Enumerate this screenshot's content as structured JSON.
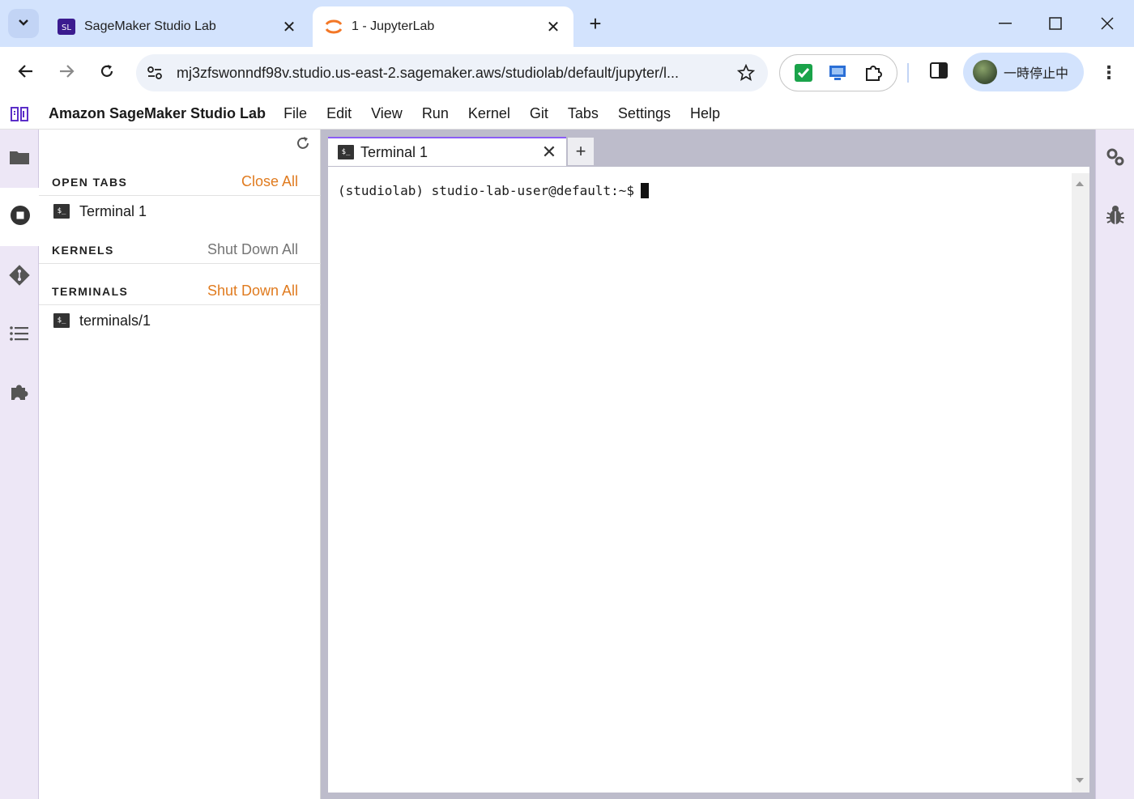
{
  "browser": {
    "tabs": [
      {
        "title": "SageMaker Studio Lab",
        "active": false
      },
      {
        "title": "1 - JupyterLab",
        "active": true
      }
    ],
    "url": "mj3zfswonndf98v.studio.us-east-2.sagemaker.aws/studiolab/default/jupyter/l...",
    "profile_label": "一時停止中",
    "new_tab_icon": "plus-icon",
    "more_icon": "more-vert-icon"
  },
  "jupyter": {
    "app_title": "Amazon SageMaker Studio Lab",
    "menu": [
      "File",
      "Edit",
      "View",
      "Run",
      "Kernel",
      "Git",
      "Tabs",
      "Settings",
      "Help"
    ],
    "running_panel": {
      "open_tabs": {
        "title": "OPEN TABS",
        "action": "Close All",
        "items": [
          "Terminal 1"
        ]
      },
      "kernels": {
        "title": "KERNELS",
        "action": "Shut Down All",
        "items": []
      },
      "terminals": {
        "title": "TERMINALS",
        "action": "Shut Down All",
        "items": [
          "terminals/1"
        ]
      }
    },
    "dock_tab": {
      "label": "Terminal 1"
    },
    "terminal": {
      "prompt": "(studiolab) studio-lab-user@default:~$"
    },
    "colors": {
      "accent": "#e07b1f",
      "tab_indicator": "#8b5cf6",
      "activity_bg": "#ede7f6"
    }
  }
}
